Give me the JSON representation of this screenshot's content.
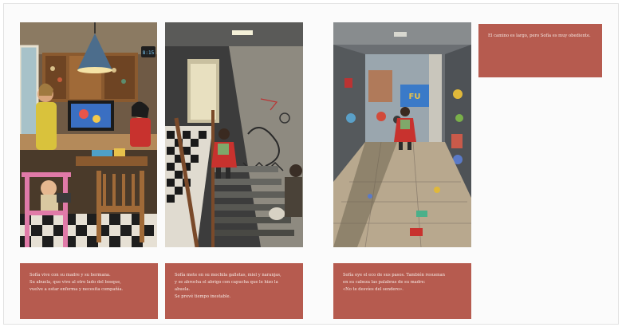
{
  "pages": {
    "scene_1": {
      "text_lines": [
        "Sofía vive con su madre y su hermana.",
        "Su abuela, que vive al otro lado del bosque,",
        "vuelve a estar enferma y necesita compañía."
      ]
    },
    "scene_2": {
      "text_lines": [
        "Sofía mete en su mochila galletas, miel y naranjas,",
        "y se abrocha el abrigo con capucha que le hizo la abuela.",
        "Se prevé tiempo inestable."
      ]
    },
    "scene_3": {
      "text_lines": [
        "Sofía oye el eco de sus pasos. También resuenan",
        "en su cabeza las palabras de su madre:",
        "«No te desvíes del sendero»."
      ]
    },
    "scene_4": {
      "text_lines": [
        "El camino es largo, pero Sofía es muy obediente."
      ]
    },
    "panel_1": {
      "clock_text": "8:15"
    },
    "panel_3": {
      "sign_text": "FU"
    }
  },
  "colors": {
    "text_box": "#b65b4f",
    "text": "#f6e9e4",
    "coat_red": "#c8322e"
  }
}
